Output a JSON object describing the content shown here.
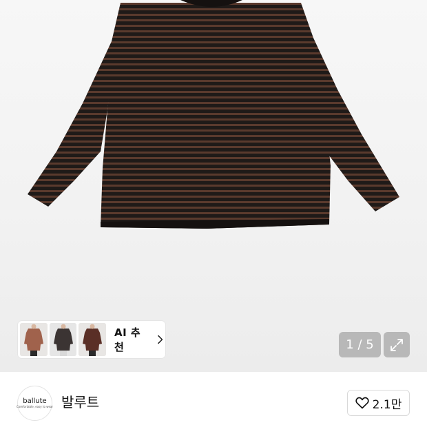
{
  "product": {
    "image_alt": "striped long sleeve tee",
    "colors": {
      "stripe_dark": "#1f1a18",
      "stripe_brown": "#5c3b2e"
    }
  },
  "ai_recommend": {
    "label": "AI 추천",
    "thumbnails": [
      "brown-tee-thumbnail",
      "charcoal-tee-thumbnail",
      "brown-stripe-tee-thumbnail"
    ]
  },
  "gallery": {
    "pager": "1 / 5"
  },
  "shop": {
    "logo_word": "ballute",
    "logo_tagline": "Comfortable, easy to wear",
    "name": "발루트",
    "like_count": "2.1만"
  }
}
